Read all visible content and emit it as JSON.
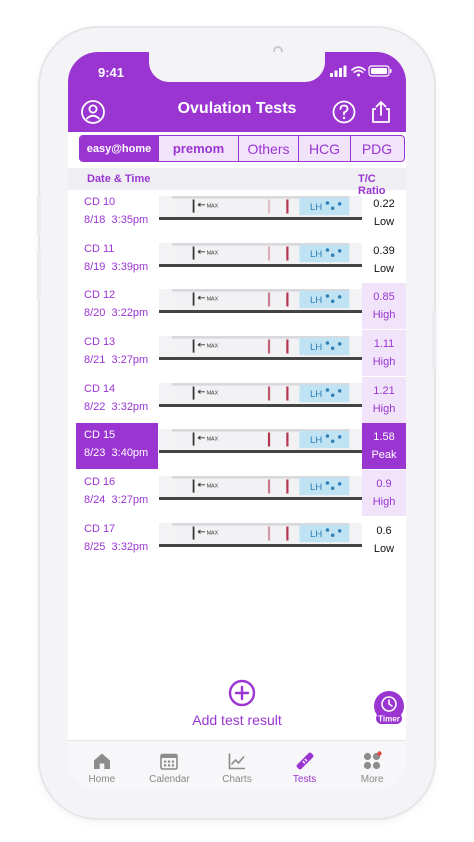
{
  "status": {
    "time": "9:41"
  },
  "header": {
    "title": "Ovulation Tests"
  },
  "brand_tabs": [
    {
      "label": "easy@home",
      "active": true
    },
    {
      "label": "premom",
      "active": false
    },
    {
      "label": "Others",
      "active": false
    },
    {
      "label": "HCG",
      "active": false
    },
    {
      "label": "PDG",
      "active": false
    }
  ],
  "columns": {
    "date_time": "Date & Time",
    "ratio": "T/C Ratio"
  },
  "tests": [
    {
      "cd": "CD 10",
      "datetime": "8/18  3:35pm",
      "ratio": "0.22",
      "level": "Low"
    },
    {
      "cd": "CD 11",
      "datetime": "8/19  3:39pm",
      "ratio": "0.39",
      "level": "Low"
    },
    {
      "cd": "CD 12",
      "datetime": "8/20  3:22pm",
      "ratio": "0.85",
      "level": "High"
    },
    {
      "cd": "CD 13",
      "datetime": "8/21  3:27pm",
      "ratio": "1.11",
      "level": "High"
    },
    {
      "cd": "CD 14",
      "datetime": "8/22  3:32pm",
      "ratio": "1.21",
      "level": "High"
    },
    {
      "cd": "CD 15",
      "datetime": "8/23  3:40pm",
      "ratio": "1.58",
      "level": "Peak"
    },
    {
      "cd": "CD 16",
      "datetime": "8/24  3:27pm",
      "ratio": "0.9",
      "level": "High"
    },
    {
      "cd": "CD 17",
      "datetime": "8/25  3:32pm",
      "ratio": "0.6",
      "level": "Low"
    }
  ],
  "strip": {
    "max_label": "MAX",
    "lh_label": "LH"
  },
  "actions": {
    "add_test": "Add test result",
    "timer": "Timer"
  },
  "tabbar": [
    {
      "label": "Home",
      "icon": "home-icon",
      "active": false
    },
    {
      "label": "Calendar",
      "icon": "calendar-icon",
      "active": false
    },
    {
      "label": "Charts",
      "icon": "chart-icon",
      "active": false
    },
    {
      "label": "Tests",
      "icon": "test-strip-icon",
      "active": true
    },
    {
      "label": "More",
      "icon": "more-icon",
      "active": false
    }
  ],
  "colors": {
    "accent": "#9b35d2",
    "accent_light": "#f1e3fa",
    "control_line": "#b2364f"
  }
}
